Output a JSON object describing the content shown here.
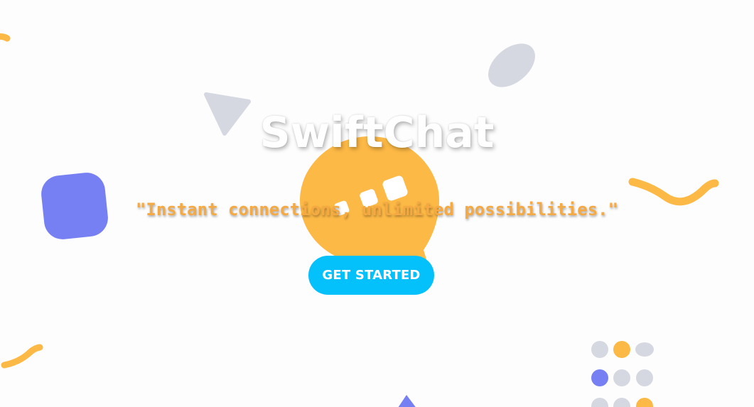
{
  "hero": {
    "title": "SwiftChat",
    "tagline": "\"Instant connections, unlimited possibilities.\"",
    "cta_label": "GET STARTED"
  },
  "colors": {
    "background": "#fdfdfe",
    "accent_yellow": "#fdb945",
    "accent_purple": "#7680f3",
    "accent_gray": "#d6d8e1",
    "cta_blue": "#04c0fb",
    "tagline_orange": "#f5a943"
  },
  "icons": {
    "logo": "chat-bubble-icon"
  }
}
